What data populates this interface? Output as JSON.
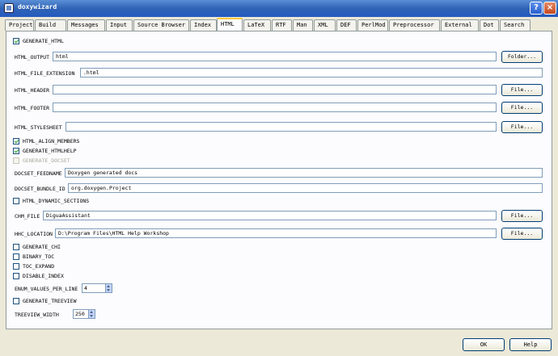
{
  "window": {
    "title": "doxywizard",
    "help_glyph": "?",
    "close_glyph": "×"
  },
  "tabs": [
    "Project",
    "Build",
    "Messages",
    "Input",
    "Source Browser",
    "Index",
    "HTML",
    "LaTeX",
    "RTF",
    "Man",
    "XML",
    "DEF",
    "PerlMod",
    "Preprocessor",
    "External",
    "Dot",
    "Search"
  ],
  "html": {
    "generate_html": {
      "label": "GENERATE_HTML",
      "checked": true
    },
    "html_output": {
      "label": "HTML_OUTPUT",
      "value": "html",
      "button": "Folder..."
    },
    "html_file_extension": {
      "label": "HTML_FILE_EXTENSION",
      "value": ".html"
    },
    "html_header": {
      "label": "HTML_HEADER",
      "value": "",
      "button": "File..."
    },
    "html_footer": {
      "label": "HTML_FOOTER",
      "value": "",
      "button": "File..."
    },
    "html_stylesheet": {
      "label": "HTML_STYLESHEET",
      "value": "",
      "button": "File..."
    },
    "html_align_members": {
      "label": "HTML_ALIGN_MEMBERS",
      "checked": true
    },
    "generate_htmlhelp": {
      "label": "GENERATE_HTMLHELP",
      "checked": true
    },
    "generate_docset": {
      "label": "GENERATE_DOCSET",
      "checked": false
    },
    "docset_feedname": {
      "label": "DOCSET_FEEDNAME",
      "value": "Doxygen generated docs"
    },
    "docset_bundle_id": {
      "label": "DOCSET_BUNDLE_ID",
      "value": "org.doxygen.Project"
    },
    "html_dynamic_sections": {
      "label": "HTML_DYNAMIC_SECTIONS",
      "checked": false
    },
    "chm_file": {
      "label": "CHM_FILE",
      "value": "DiguaAssistant",
      "button": "File..."
    },
    "hhc_location": {
      "label": "HHC_LOCATION",
      "value": "D:\\Program Files\\HTML Help Workshop",
      "button": "File..."
    },
    "generate_chi": {
      "label": "GENERATE_CHI",
      "checked": false
    },
    "binary_toc": {
      "label": "BINARY_TOC",
      "checked": false
    },
    "toc_expand": {
      "label": "TOC_EXPAND",
      "checked": false
    },
    "disable_index": {
      "label": "DISABLE_INDEX",
      "checked": false
    },
    "enum_values_per_line": {
      "label": "ENUM_VALUES_PER_LINE",
      "value": "4"
    },
    "generate_treeview": {
      "label": "GENERATE_TREEVIEW",
      "checked": false
    },
    "treeview_width": {
      "label": "TREEVIEW_WIDTH",
      "value": "250"
    }
  },
  "footer": {
    "ok": "OK",
    "help": "Help"
  }
}
